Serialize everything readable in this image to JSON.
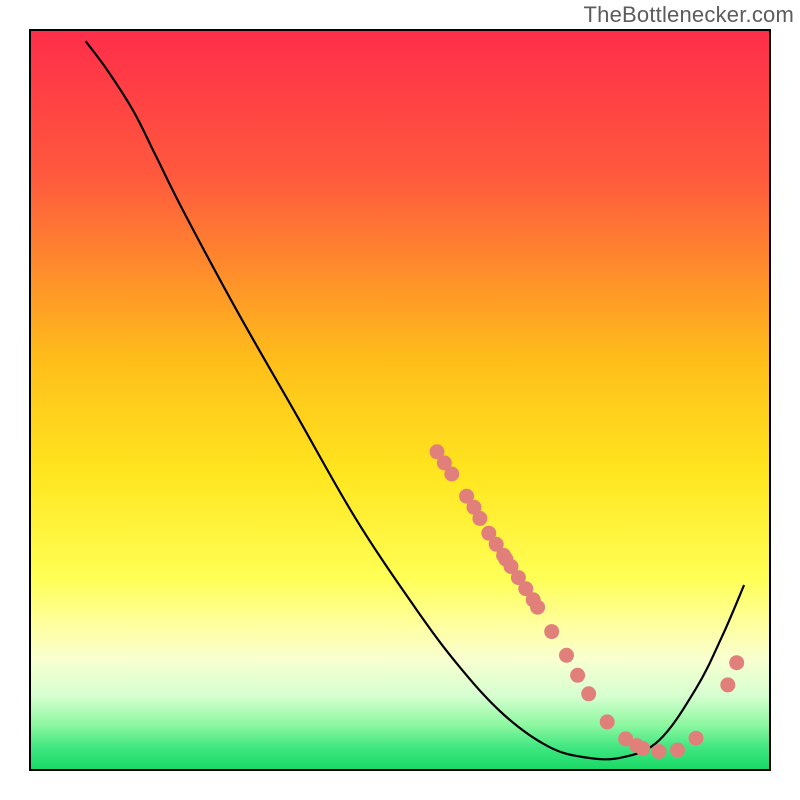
{
  "watermark": "TheBottlenecker.com",
  "chart_data": {
    "type": "line",
    "title": "",
    "xlabel": "",
    "ylabel": "",
    "xlim": [
      0,
      100
    ],
    "ylim": [
      0,
      100
    ],
    "gradient_stops": [
      {
        "offset": 0.0,
        "color": "#ff2d4a"
      },
      {
        "offset": 0.2,
        "color": "#ff5a3d"
      },
      {
        "offset": 0.45,
        "color": "#ffbf1a"
      },
      {
        "offset": 0.6,
        "color": "#ffe61f"
      },
      {
        "offset": 0.74,
        "color": "#ffff55"
      },
      {
        "offset": 0.8,
        "color": "#ffff9a"
      },
      {
        "offset": 0.85,
        "color": "#f9ffd0"
      },
      {
        "offset": 0.9,
        "color": "#d6ffd0"
      },
      {
        "offset": 0.94,
        "color": "#8bf79f"
      },
      {
        "offset": 0.97,
        "color": "#3fe681"
      },
      {
        "offset": 1.0,
        "color": "#17d964"
      }
    ],
    "series": [
      {
        "name": "bottleneck-curve",
        "points": [
          {
            "x": 7.5,
            "y": 98.5
          },
          {
            "x": 10.5,
            "y": 94.5
          },
          {
            "x": 14.0,
            "y": 89.0
          },
          {
            "x": 17.0,
            "y": 83.0
          },
          {
            "x": 21.0,
            "y": 75.0
          },
          {
            "x": 28.0,
            "y": 62.0
          },
          {
            "x": 36.0,
            "y": 48.0
          },
          {
            "x": 44.0,
            "y": 34.0
          },
          {
            "x": 52.0,
            "y": 22.0
          },
          {
            "x": 58.0,
            "y": 14.0
          },
          {
            "x": 64.0,
            "y": 7.5
          },
          {
            "x": 70.0,
            "y": 3.2
          },
          {
            "x": 75.0,
            "y": 1.7
          },
          {
            "x": 80.0,
            "y": 1.7
          },
          {
            "x": 85.0,
            "y": 4.0
          },
          {
            "x": 90.0,
            "y": 11.0
          },
          {
            "x": 93.5,
            "y": 18.0
          },
          {
            "x": 96.5,
            "y": 25.0
          }
        ]
      }
    ],
    "markers": [
      {
        "x": 55.0,
        "y": 43.0,
        "r": 7.5
      },
      {
        "x": 56.0,
        "y": 41.5,
        "r": 7.5
      },
      {
        "x": 57.0,
        "y": 40.0,
        "r": 7.5
      },
      {
        "x": 59.0,
        "y": 37.0,
        "r": 7.5
      },
      {
        "x": 60.0,
        "y": 35.5,
        "r": 7.5
      },
      {
        "x": 60.8,
        "y": 34.0,
        "r": 7.5
      },
      {
        "x": 62.0,
        "y": 32.0,
        "r": 7.5
      },
      {
        "x": 63.0,
        "y": 30.5,
        "r": 7.5
      },
      {
        "x": 64.0,
        "y": 29.0,
        "r": 7.5
      },
      {
        "x": 64.3,
        "y": 28.5,
        "r": 7.5
      },
      {
        "x": 65.0,
        "y": 27.5,
        "r": 7.5
      },
      {
        "x": 66.0,
        "y": 26.0,
        "r": 7.5
      },
      {
        "x": 67.0,
        "y": 24.5,
        "r": 7.5
      },
      {
        "x": 68.0,
        "y": 23.0,
        "r": 7.5
      },
      {
        "x": 68.6,
        "y": 22.0,
        "r": 7.5
      },
      {
        "x": 70.5,
        "y": 18.7,
        "r": 7.5
      },
      {
        "x": 72.5,
        "y": 15.5,
        "r": 7.5
      },
      {
        "x": 74.0,
        "y": 12.8,
        "r": 7.5
      },
      {
        "x": 75.5,
        "y": 10.3,
        "r": 7.5
      },
      {
        "x": 78.0,
        "y": 6.5,
        "r": 7.5
      },
      {
        "x": 80.5,
        "y": 4.2,
        "r": 7.5
      },
      {
        "x": 82.0,
        "y": 3.3,
        "r": 7.5
      },
      {
        "x": 82.8,
        "y": 2.9,
        "r": 7.5
      },
      {
        "x": 85.0,
        "y": 2.5,
        "r": 7.5
      },
      {
        "x": 87.5,
        "y": 2.7,
        "r": 7.5
      },
      {
        "x": 90.0,
        "y": 4.3,
        "r": 7.5
      },
      {
        "x": 94.3,
        "y": 11.5,
        "r": 7.5
      },
      {
        "x": 95.5,
        "y": 14.5,
        "r": 7.5
      }
    ],
    "marker_color": "#e1807b",
    "curve_color": "#000000"
  }
}
